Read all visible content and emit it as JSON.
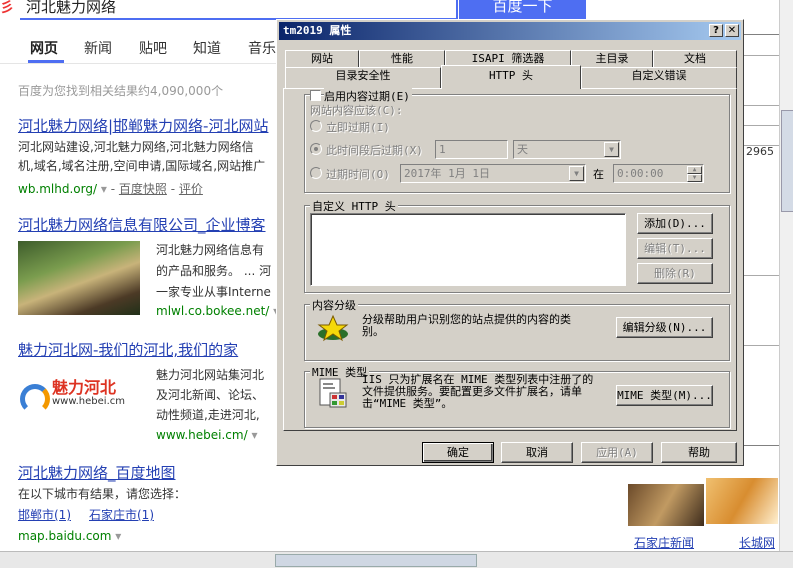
{
  "search": {
    "query": "河北魅力网络",
    "button": "百度一下"
  },
  "nav": {
    "tabs": [
      "网页",
      "新闻",
      "贴吧",
      "知道",
      "音乐"
    ]
  },
  "stats": "百度为您找到相关结果约4,090,000个",
  "results": [
    {
      "title": "河北魅力网络|邯郸魅力网络-河北网站",
      "lines": [
        "河北网站建设,河北魅力网络,河北魅力网络信",
        "机,域名,域名注册,空间申请,国际域名,网站推广"
      ],
      "url": "wb.mlhd.org/",
      "extra": [
        "百度快照",
        "评价"
      ]
    },
    {
      "title": "河北魅力网络信息有限公司_企业博客",
      "lines": [
        "河北魅力网络信息有",
        "的产品和服务。 ... 河",
        "一家专业从事Interne"
      ],
      "url": "mlwl.co.bokee.net/"
    },
    {
      "title": "魅力河北网-我们的河北,我们的家",
      "lines": [
        "魅力河北网站集河北",
        "及河北新闻、论坛、",
        "动性频道,走进河北,"
      ],
      "url": "www.hebei.cm/"
    },
    {
      "title": "河北魅力网络_百度地图",
      "lines": [
        "在以下城市有结果，请您选择："
      ],
      "links": [
        "邯郸市(1)",
        "石家庄市(1)"
      ],
      "url": "map.baidu.com"
    }
  ],
  "thumb2": {
    "brand": "魅力河北",
    "url": "www.hebei.cm"
  },
  "right_bg": {
    "number": "2965",
    "caption1": "石家庄新闻",
    "caption2": "长城网"
  },
  "dialog": {
    "title": "tm2019 属性",
    "help_btn": "?",
    "close_btn": "✕",
    "tabs_back": [
      "网站",
      "性能",
      "ISAPI 筛选器",
      "主目录",
      "文档"
    ],
    "tabs_front": [
      "目录安全性",
      "HTTP 头",
      "自定义错误"
    ],
    "expire": {
      "checkbox": "启用内容过期(E)",
      "label": "网站内容应该(C):",
      "opt_now": "立即过期(I)",
      "opt_after": "此时间段后过期(X)",
      "after_value": "1",
      "after_unit": "天",
      "opt_at": "过期时间(O)",
      "at_date": "2017年 1月 1日",
      "at_word": "在",
      "at_time": "0:00:00"
    },
    "custom_http": {
      "legend": "自定义 HTTP 头",
      "add": "添加(D)...",
      "edit": "编辑(T)...",
      "delete": "删除(R)"
    },
    "rating": {
      "legend": "内容分级",
      "desc": "分级帮助用户识别您的站点提供的内容的类别。",
      "button": "编辑分级(N)..."
    },
    "mime": {
      "legend": "MIME 类型",
      "desc": "IIS 只为扩展名在 MIME 类型列表中注册了的文件提供服务。要配置更多文件扩展名，请单击“MIME 类型”。",
      "button": "MIME 类型(M)..."
    },
    "footer": {
      "ok": "确定",
      "cancel": "取消",
      "apply": "应用(A)",
      "help": "帮助"
    }
  }
}
